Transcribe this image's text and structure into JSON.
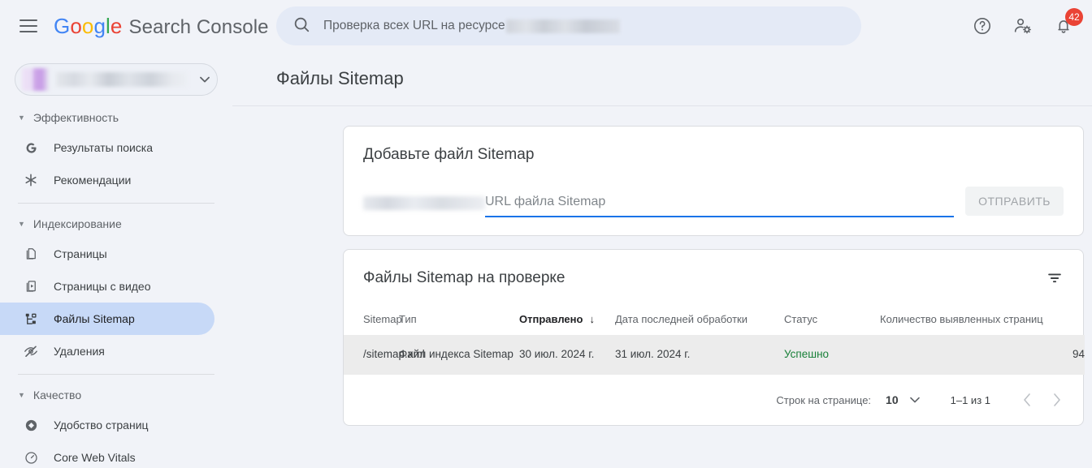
{
  "topbar": {
    "menu_icon": "hamburger-menu-icon",
    "logo_text": "Google",
    "product_name": "Search Console",
    "search": {
      "icon": "search-icon",
      "placeholder": "Проверка всех URL на ресурсе",
      "redacted_value": ""
    },
    "help_icon": "help-circle-icon",
    "account_icon": "account-settings-icon",
    "notifications_icon": "bell-icon",
    "notifications_count": "42",
    "badge_color": "#ea4335"
  },
  "sidebar": {
    "property_selector": {
      "label": "",
      "caret_icon": "chevron-down-icon"
    },
    "groups": [
      {
        "title": "Эффективность",
        "items": [
          {
            "label": "Результаты поиска",
            "icon": "google-g-icon",
            "active": false
          },
          {
            "label": "Рекомендации",
            "icon": "asterisk-icon",
            "active": false
          }
        ]
      },
      {
        "title": "Индексирование",
        "items": [
          {
            "label": "Страницы",
            "icon": "pages-icon",
            "active": false
          },
          {
            "label": "Страницы с видео",
            "icon": "video-pages-icon",
            "active": false
          },
          {
            "label": "Файлы Sitemap",
            "icon": "sitemap-tree-icon",
            "active": true
          },
          {
            "label": "Удаления",
            "icon": "eye-off-icon",
            "active": false
          }
        ]
      },
      {
        "title": "Качество",
        "items": [
          {
            "label": "Удобство страниц",
            "icon": "page-experience-icon",
            "active": false
          },
          {
            "label": "Core Web Vitals",
            "icon": "speed-gauge-icon",
            "active": false
          }
        ]
      }
    ]
  },
  "main": {
    "page_title": "Файлы Sitemap",
    "add_card": {
      "title": "Добавьте файл Sitemap",
      "url_prefix_redacted": "",
      "input_placeholder": "URL файла Sitemap",
      "input_value": "",
      "submit_label": "ОТПРАВИТЬ"
    },
    "table_card": {
      "title": "Файлы Sitemap на проверке",
      "filter_icon": "filter-icon",
      "columns": [
        {
          "label": "Sitemap",
          "sorted": false
        },
        {
          "label": "Тип",
          "sorted": false
        },
        {
          "label": "Отправлено",
          "sorted": true,
          "sort_arrow": "↓"
        },
        {
          "label": "Дата последней обработки",
          "sorted": false
        },
        {
          "label": "Статус",
          "sorted": false
        },
        {
          "label": "Количество выявленных страниц",
          "sorted": false
        }
      ],
      "rows": [
        {
          "sitemap": "/sitemap.xml",
          "type": "Файл индекса Sitemap",
          "submitted": "30 июл. 2024 г.",
          "last_read": "31 июл. 2024 г.",
          "status": "Успешно",
          "status_color": "#188038",
          "discovered_pages": "94"
        }
      ],
      "pagination": {
        "rows_per_page_label": "Строк на странице:",
        "rows_per_page_value": "10",
        "rows_per_page_caret": "chevron-down-icon",
        "range_label": "1–1 из 1",
        "prev_icon": "chevron-left-icon",
        "next_icon": "chevron-right-icon"
      }
    }
  },
  "colors": {
    "accent": "#1a73e8",
    "active_nav": "#c7d9f7",
    "app_background": "#f1f3f8",
    "success": "#188038"
  }
}
